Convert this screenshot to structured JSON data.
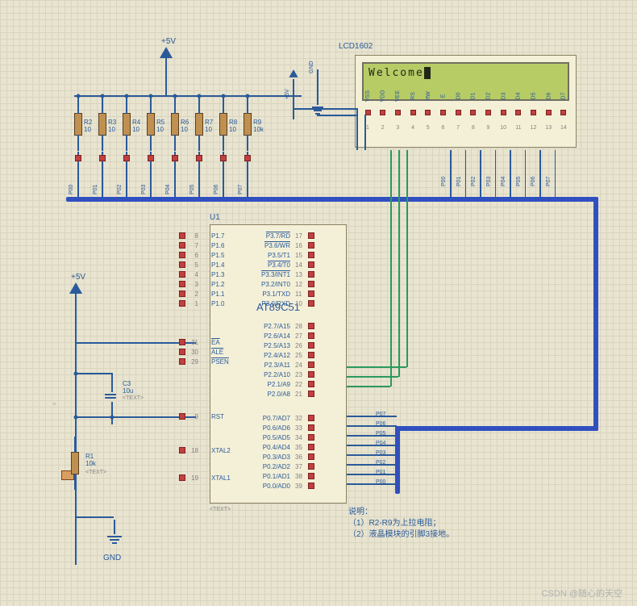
{
  "power": {
    "v5_1": "+5V",
    "v5_2": "+5V",
    "v5_3": "+5V",
    "gnd1": "GND",
    "gnd2": "GND"
  },
  "resistors": {
    "R1": {
      "name": "R1",
      "value": "10k"
    },
    "R2": {
      "name": "R2",
      "value": "10"
    },
    "R3": {
      "name": "R3",
      "value": "10"
    },
    "R4": {
      "name": "R4",
      "value": "10"
    },
    "R5": {
      "name": "R5",
      "value": "10"
    },
    "R6": {
      "name": "R6",
      "value": "10"
    },
    "R7": {
      "name": "R7",
      "value": "10"
    },
    "R8": {
      "name": "R8",
      "value": "10"
    },
    "R9": {
      "name": "R9",
      "value": "10k"
    }
  },
  "cap": {
    "C3": {
      "name": "C3",
      "value": "10u"
    }
  },
  "u1": {
    "ref": "U1",
    "part": "AT89C51",
    "left_pins": [
      {
        "num": "8",
        "name": "P1.7"
      },
      {
        "num": "7",
        "name": "P1.6"
      },
      {
        "num": "6",
        "name": "P1.5"
      },
      {
        "num": "5",
        "name": "P1.4"
      },
      {
        "num": "4",
        "name": "P1.3"
      },
      {
        "num": "3",
        "name": "P1.2"
      },
      {
        "num": "2",
        "name": "P1.1"
      },
      {
        "num": "1",
        "name": "P1.0"
      }
    ],
    "left_pins2": [
      {
        "num": "31",
        "name": "EA",
        "ov": true
      },
      {
        "num": "30",
        "name": "ALE",
        "ov": true
      },
      {
        "num": "29",
        "name": "PSEN",
        "ov": true
      }
    ],
    "rst": {
      "num": "9",
      "name": "RST"
    },
    "xtal": [
      {
        "num": "18",
        "name": "XTAL2"
      },
      {
        "num": "19",
        "name": "XTAL1"
      }
    ],
    "right_p3": [
      {
        "num": "17",
        "name": "P3.7/RD",
        "ov": true
      },
      {
        "num": "16",
        "name": "P3.6/WR",
        "ov": true
      },
      {
        "num": "15",
        "name": "P3.5/T1"
      },
      {
        "num": "14",
        "name": "P3.4/T0",
        "ov": true
      },
      {
        "num": "13",
        "name": "P3.3/INT1",
        "ov": true
      },
      {
        "num": "12",
        "name": "P3.2/INT0"
      },
      {
        "num": "11",
        "name": "P3.1/TXD"
      },
      {
        "num": "10",
        "name": "P3.0/RXD"
      }
    ],
    "right_p2": [
      {
        "num": "28",
        "name": "P2.7/A15"
      },
      {
        "num": "27",
        "name": "P2.6/A14"
      },
      {
        "num": "26",
        "name": "P2.5/A13"
      },
      {
        "num": "25",
        "name": "P2.4/A12"
      },
      {
        "num": "24",
        "name": "P2.3/A11"
      },
      {
        "num": "23",
        "name": "P2.2/A10"
      },
      {
        "num": "22",
        "name": "P2.1/A9"
      },
      {
        "num": "21",
        "name": "P2.0/A8"
      }
    ],
    "right_p0": [
      {
        "num": "32",
        "name": "P0.7/AD7"
      },
      {
        "num": "33",
        "name": "P0.6/AD6"
      },
      {
        "num": "34",
        "name": "P0.5/AD5"
      },
      {
        "num": "35",
        "name": "P0.4/AD4"
      },
      {
        "num": "36",
        "name": "P0.3/AD3"
      },
      {
        "num": "37",
        "name": "P0.2/AD2"
      },
      {
        "num": "38",
        "name": "P0.1/AD1"
      },
      {
        "num": "39",
        "name": "P0.0/AD0"
      }
    ]
  },
  "lcd": {
    "title": "LCD1602",
    "display": "Welcome",
    "pins": [
      "VSS",
      "VDD",
      "VEE",
      "RS",
      "RW",
      "E",
      "D0",
      "D1",
      "D2",
      "D3",
      "D4",
      "D5",
      "D6",
      "D7"
    ],
    "nums": [
      "1",
      "2",
      "3",
      "4",
      "5",
      "6",
      "7",
      "8",
      "9",
      "10",
      "11",
      "12",
      "13",
      "14"
    ]
  },
  "bus_labels_top": [
    "P00",
    "P01",
    "P02",
    "P03",
    "P04",
    "P05",
    "P06",
    "P07"
  ],
  "bus_labels_lcd": [
    "P00",
    "P01",
    "P02",
    "P03",
    "P04",
    "P05",
    "P06",
    "P07"
  ],
  "bus_labels_p0": [
    "P07",
    "P06",
    "P05",
    "P04",
    "P03",
    "P02",
    "P01",
    "P00"
  ],
  "annotation": {
    "title": "说明：",
    "line1": "（1）R2-R9为上拉电阻；",
    "line2": "（2）液晶模块的引脚3接地。"
  },
  "text_tag": "<TEXT>",
  "watermark": "CSDN @随心的天空"
}
